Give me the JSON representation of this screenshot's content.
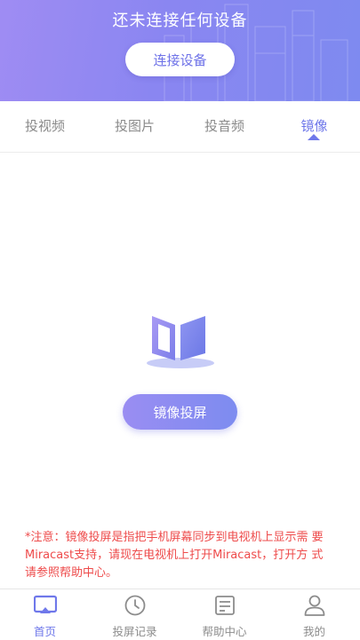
{
  "header": {
    "title": "还未连接任何设备",
    "connect_button": "连接设备"
  },
  "tabs": [
    {
      "label": "投视频",
      "active": false
    },
    {
      "label": "投图片",
      "active": false
    },
    {
      "label": "投音频",
      "active": false
    },
    {
      "label": "镜像",
      "active": true
    }
  ],
  "main": {
    "hero_icon": "mirror-book-icon",
    "mirror_button": "镜像投屏",
    "notice": "*注意：镜像投屏是指把手机屏幕同步到电视机上显示需 要Miracast支持，请现在电视机上打开Miracast，打开方 式请参照帮助中心。"
  },
  "bottom_nav": [
    {
      "label": "首页",
      "icon": "cast-screen-icon",
      "active": true
    },
    {
      "label": "投屏记录",
      "icon": "clock-icon",
      "active": false
    },
    {
      "label": "帮助中心",
      "icon": "document-icon",
      "active": false
    },
    {
      "label": "我的",
      "icon": "user-icon",
      "active": false
    }
  ],
  "colors": {
    "accent": "#6f78ea",
    "header_start": "#9f8cf3",
    "header_end": "#7e8af0",
    "notice": "#ee4b4b"
  }
}
